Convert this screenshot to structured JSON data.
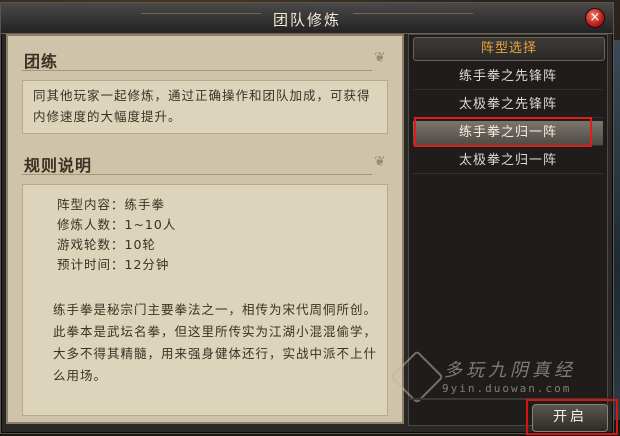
{
  "window": {
    "title": "团队修炼"
  },
  "left": {
    "section1": {
      "heading": "团练",
      "body": "同其他玩家一起修炼，通过正确操作和团队加成，可获得内修速度的大幅度提升。"
    },
    "section2": {
      "heading": "规则说明",
      "info": [
        "阵型内容：练手拳",
        "修炼人数：1~10人",
        "游戏轮数：10轮",
        "预计时间：12分钟"
      ],
      "description": "练手拳是秘宗门主要拳法之一，相传为宋代周侗所创。此拳本是武坛名拳，但这里所传实为江湖小混混偷学，大多不得其精髓，用来强身健体还行，实战中派不上什么用场。"
    }
  },
  "right": {
    "header": "阵型选择",
    "items": [
      {
        "label": "练手拳之先锋阵",
        "selected": false
      },
      {
        "label": "太极拳之先锋阵",
        "selected": false
      },
      {
        "label": "练手拳之归一阵",
        "selected": true
      },
      {
        "label": "太极拳之归一阵",
        "selected": false
      }
    ]
  },
  "buttons": {
    "start": "开启",
    "close": "×"
  },
  "watermark": {
    "text": "多玩九阴真经",
    "url": "9yin.duowan.com"
  },
  "colors": {
    "accent": "#e8a33a",
    "highlight_outline": "#e21b1b",
    "parchment": "#cfc4a9"
  }
}
